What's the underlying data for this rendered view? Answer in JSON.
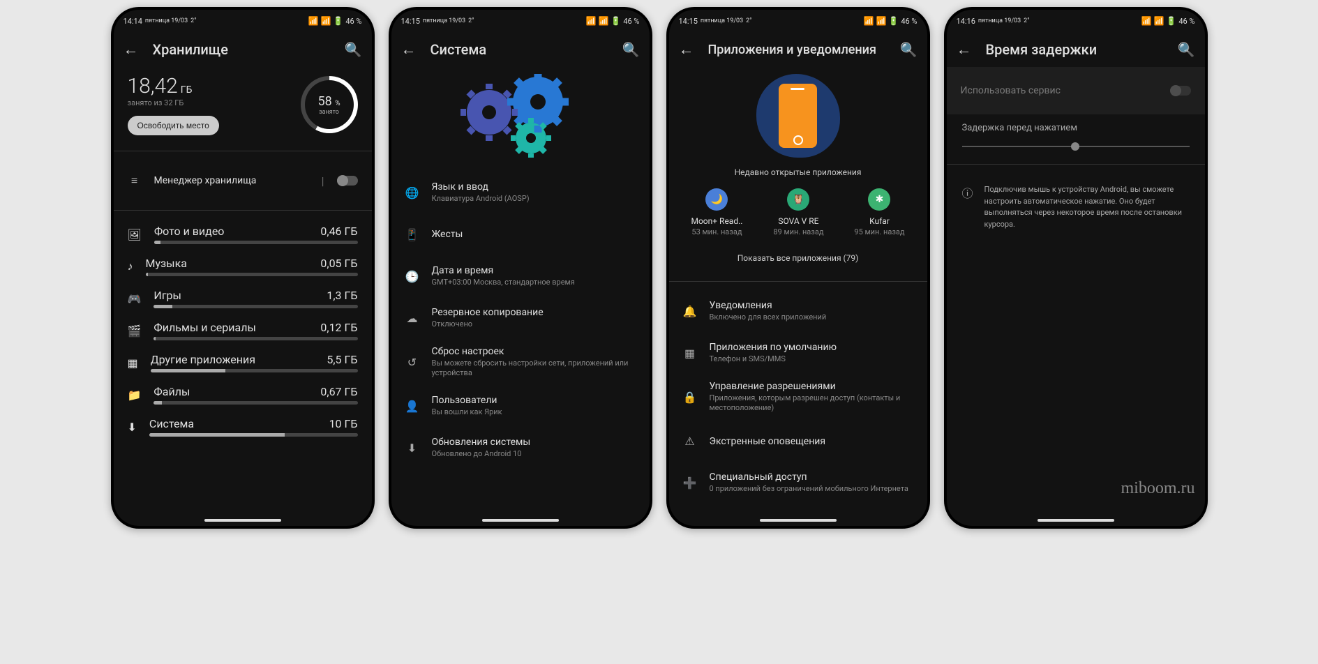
{
  "statusbar_battery": "46 %",
  "phones": [
    {
      "time": "14:14",
      "date": "пятница 19/03",
      "temp": "2°",
      "title": "Хранилище",
      "storage": {
        "used": "18,42",
        "unit": "ГБ",
        "total": "занято из 32 ГБ",
        "free_btn": "Освободить место",
        "ring_pct": "58",
        "ring_unit": "%",
        "ring_label": "занято"
      },
      "manager": "Менеджер хранилища",
      "cats": [
        {
          "ic": "🖼",
          "lbl": "Фото и видео",
          "val": "0,46 ГБ",
          "pct": 3
        },
        {
          "ic": "♪",
          "lbl": "Музыка",
          "val": "0,05 ГБ",
          "pct": 1
        },
        {
          "ic": "🎮",
          "lbl": "Игры",
          "val": "1,3 ГБ",
          "pct": 9
        },
        {
          "ic": "🎬",
          "lbl": "Фильмы и сериалы",
          "val": "0,12 ГБ",
          "pct": 1
        },
        {
          "ic": "▦",
          "lbl": "Другие приложения",
          "val": "5,5 ГБ",
          "pct": 36
        },
        {
          "ic": "📁",
          "lbl": "Файлы",
          "val": "0,67 ГБ",
          "pct": 4
        },
        {
          "ic": "⬇",
          "lbl": "Система",
          "val": "10 ГБ",
          "pct": 65
        }
      ]
    },
    {
      "time": "14:15",
      "date": "пятница 19/03",
      "temp": "2°",
      "title": "Система",
      "items": [
        {
          "ic": "🌐",
          "lbl": "Язык и ввод",
          "sub": "Клавиатура Android (AOSP)"
        },
        {
          "ic": "📱",
          "lbl": "Жесты",
          "sub": ""
        },
        {
          "ic": "🕒",
          "lbl": "Дата и время",
          "sub": "GMT+03:00 Москва, стандартное время"
        },
        {
          "ic": "☁",
          "lbl": "Резервное копирование",
          "sub": "Отключено"
        },
        {
          "ic": "↺",
          "lbl": "Сброс настроек",
          "sub": "Вы можете сбросить настройки сети, приложений или устройства"
        },
        {
          "ic": "👤",
          "lbl": "Пользователи",
          "sub": "Вы вошли как Ярик"
        },
        {
          "ic": "⬇",
          "lbl": "Обновления системы",
          "sub": "Обновлено до Android 10"
        }
      ]
    },
    {
      "time": "14:15",
      "date": "пятница 19/03",
      "temp": "2°",
      "title": "Приложения и уведомления",
      "recent_title": "Недавно открытые приложения",
      "recent": [
        {
          "col": "#4a7fd8",
          "ic": "🌙",
          "nm": "Moon+ Read..",
          "tm": "53 мин. назад"
        },
        {
          "col": "#2aa876",
          "ic": "🦉",
          "nm": "SOVA V RE",
          "tm": "89 мин. назад"
        },
        {
          "col": "#3cb371",
          "ic": "✱",
          "nm": "Kufar",
          "tm": "95 мин. назад"
        }
      ],
      "show_all": "Показать все приложения (79)",
      "items": [
        {
          "ic": "🔔",
          "lbl": "Уведомления",
          "sub": "Включено для всех приложений"
        },
        {
          "ic": "▦",
          "lbl": "Приложения по умолчанию",
          "sub": "Телефон и SMS/MMS"
        },
        {
          "ic": "🔒",
          "lbl": "Управление разрешениями",
          "sub": "Приложения, которым разрешен доступ (контакты и местоположение)"
        },
        {
          "ic": "⚠",
          "lbl": "Экстренные оповещения",
          "sub": ""
        },
        {
          "ic": "➕",
          "lbl": "Специальный доступ",
          "sub": "0 приложений без ограничений мобильного Интернета"
        }
      ]
    },
    {
      "time": "14:16",
      "date": "пятница 19/03",
      "temp": "2°",
      "title": "Время задержки",
      "service": "Использовать сервис",
      "delay_label": "Задержка перед нажатием",
      "info": "Подключив мышь к устройству Android, вы сможете настроить автоматическое нажатие. Оно будет выполняться через некоторое время после остановки курсора.",
      "watermark": "miboom.ru"
    }
  ]
}
